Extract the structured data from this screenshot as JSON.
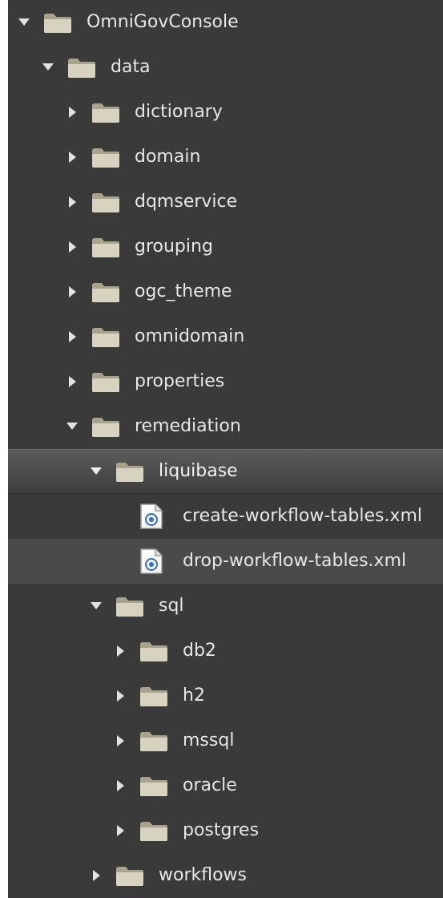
{
  "tree": {
    "root": {
      "label": "OmniGovConsole",
      "expanded": true
    },
    "data": {
      "label": "data",
      "expanded": true
    },
    "dictionary": {
      "label": "dictionary",
      "expanded": false
    },
    "domain": {
      "label": "domain",
      "expanded": false
    },
    "dqmservice": {
      "label": "dqmservice",
      "expanded": false
    },
    "grouping": {
      "label": "grouping",
      "expanded": false
    },
    "ogc_theme": {
      "label": "ogc_theme",
      "expanded": false
    },
    "omnidomain": {
      "label": "omnidomain",
      "expanded": false
    },
    "properties": {
      "label": "properties",
      "expanded": false
    },
    "remediation": {
      "label": "remediation",
      "expanded": true
    },
    "liquibase": {
      "label": "liquibase",
      "expanded": true,
      "selected": true
    },
    "create_workflow_tables": {
      "label": "create-workflow-tables.xml"
    },
    "drop_workflow_tables": {
      "label": "drop-workflow-tables.xml"
    },
    "sql": {
      "label": "sql",
      "expanded": true
    },
    "db2": {
      "label": "db2",
      "expanded": false
    },
    "h2": {
      "label": "h2",
      "expanded": false
    },
    "mssql": {
      "label": "mssql",
      "expanded": false
    },
    "oracle": {
      "label": "oracle",
      "expanded": false
    },
    "postgres": {
      "label": "postgres",
      "expanded": false
    },
    "workflows": {
      "label": "workflows",
      "expanded": false
    }
  },
  "icons": {
    "folder": "folder-icon",
    "xml_file": "xml-file-icon",
    "expanded_arrow": "chevron-down-icon",
    "collapsed_arrow": "chevron-right-icon"
  },
  "colors": {
    "panel_bg": "#3a3a3a",
    "text": "#e7e7e7",
    "folder_light": "#d8d3c1",
    "folder_dark": "#a9a28d",
    "selection": "#5b5b5b"
  }
}
